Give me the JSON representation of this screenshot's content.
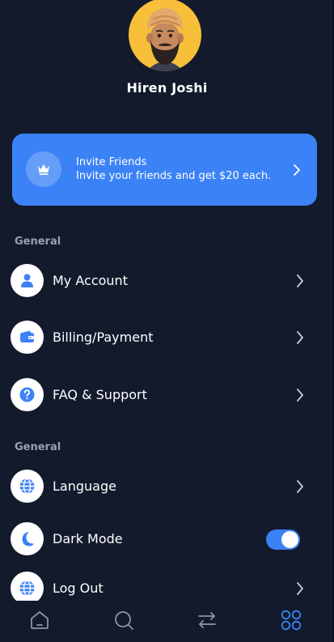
{
  "profile": {
    "name": "Hiren Joshi"
  },
  "invite": {
    "title": "Invite Friends",
    "subtitle": "Invite your friends and get $20 each."
  },
  "sections": [
    {
      "label": "General"
    },
    {
      "label": "General"
    }
  ],
  "menu": {
    "account": "My Account",
    "billing": "Billing/Payment",
    "faq": "FAQ & Support",
    "language": "Language",
    "dark_mode": "Dark Mode",
    "logout": "Log Out"
  },
  "dark_mode_enabled": true,
  "nav": {
    "items": [
      "home-icon",
      "search-icon",
      "transfer-icon",
      "apps-grid-icon"
    ],
    "active": "apps-grid-icon"
  },
  "colors": {
    "background": "#121a2c",
    "accent": "#3b82f6",
    "muted": "#9aa1ae",
    "avatar_bg": "#f7bf3a"
  }
}
